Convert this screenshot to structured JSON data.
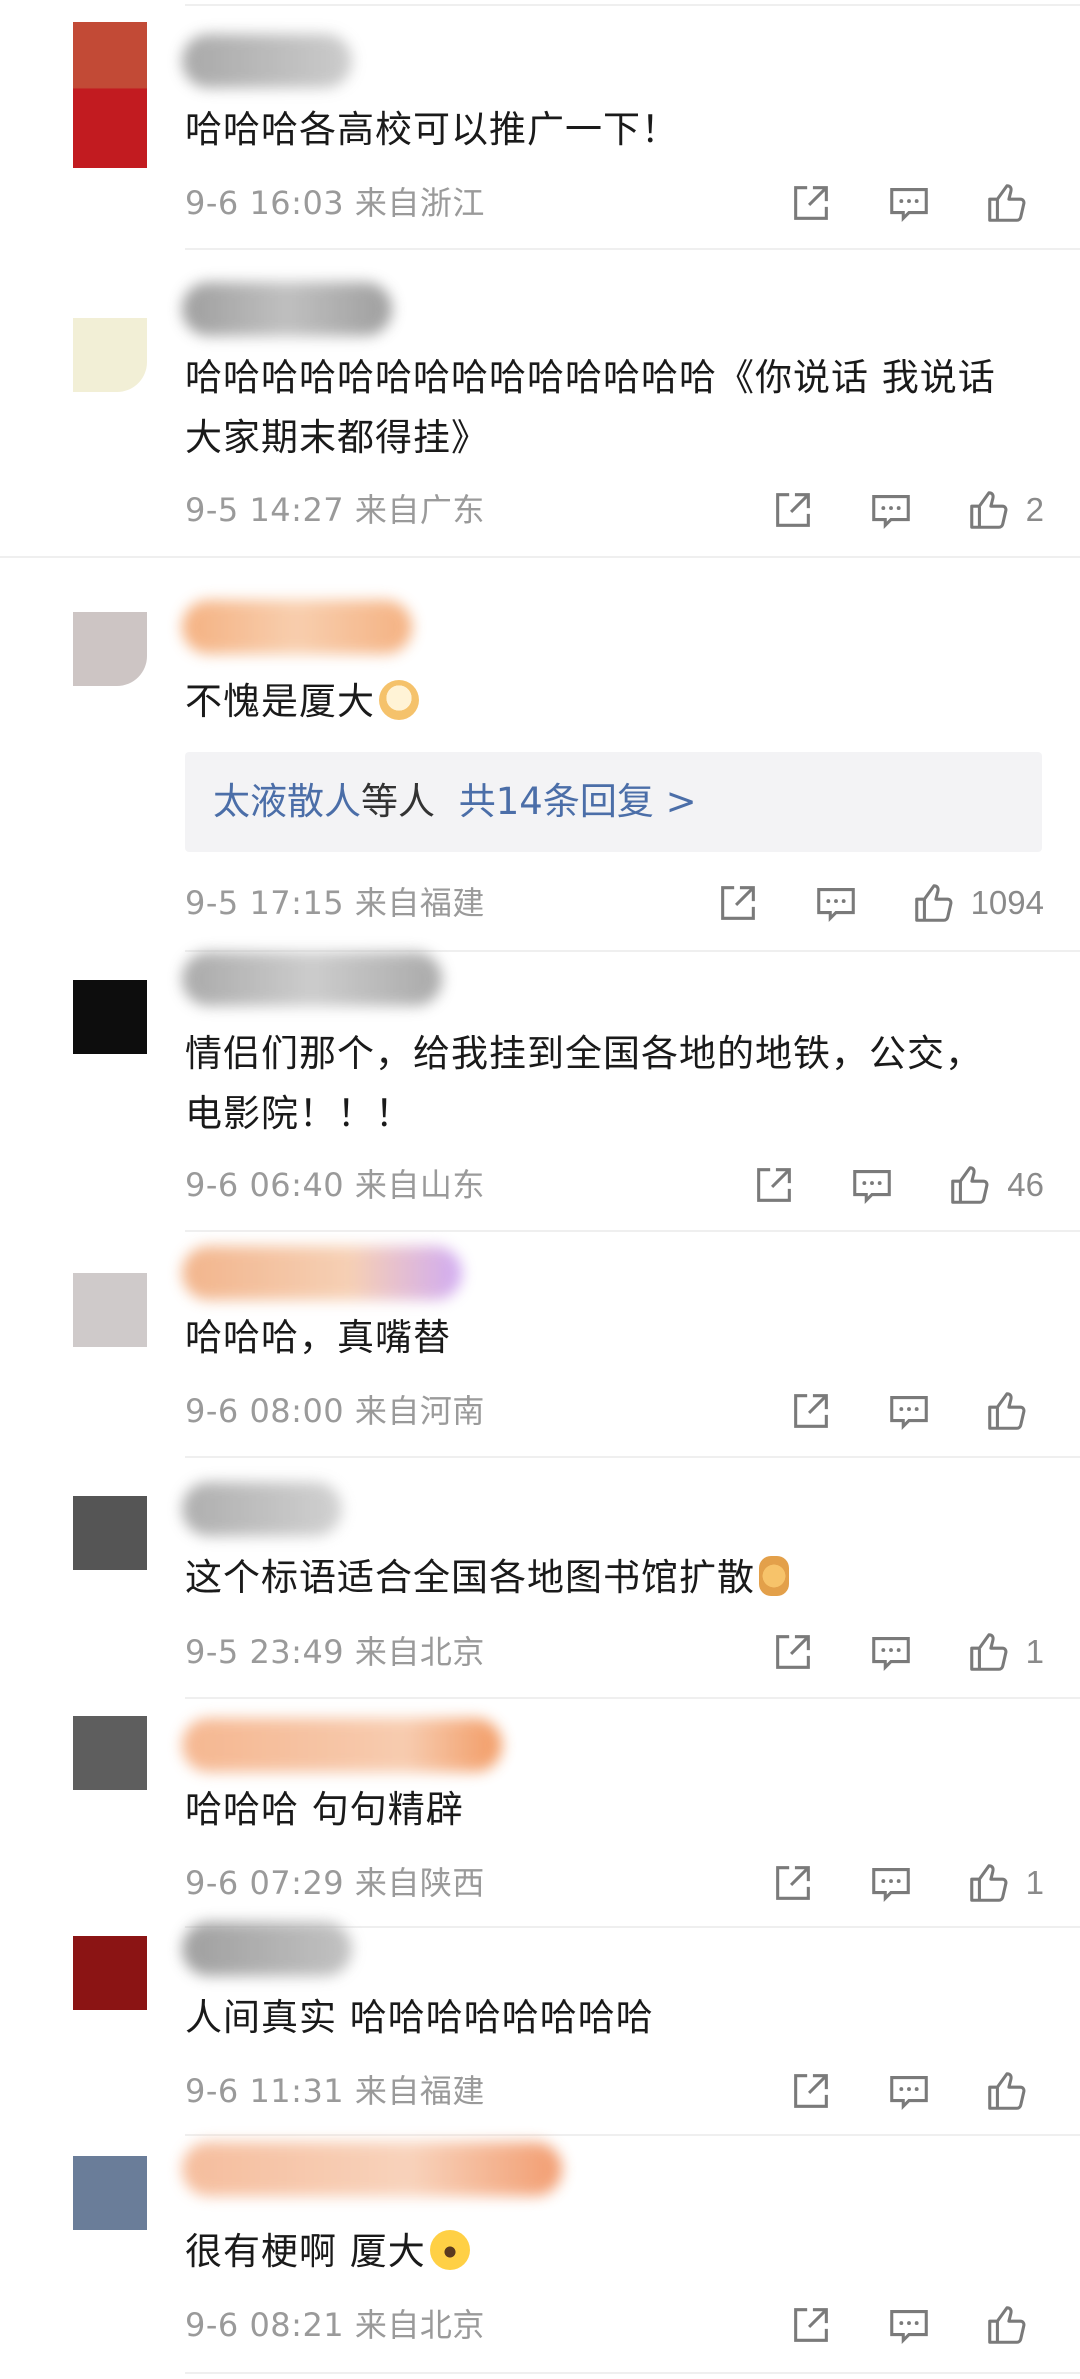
{
  "comments": [
    {
      "avatar_color": "#c0392b",
      "name_colors": [
        "#9a9a9a",
        "#b5b5b5"
      ],
      "text": "哈哈哈各高校可以推广一下！",
      "time": "9-6 16:03",
      "location": "来自浙江",
      "likes": ""
    },
    {
      "avatar_color": "#f2efd6",
      "name_colors": [
        "#8e8e8e",
        "#a8a8a8"
      ],
      "text": "哈哈哈哈哈哈哈哈哈哈哈哈哈哈《你说话 我说话 大家期末都得挂》",
      "time": "9-5 14:27",
      "location": "来自广东",
      "likes": "2"
    },
    {
      "avatar_color": "#cdc5c4",
      "name_colors": [
        "#f2a46f",
        "#f7b98a"
      ],
      "text": "不愧是厦大",
      "emoji": "dog-emoji",
      "reply": {
        "names": "太液散人",
        "middle": "等人",
        "count": "共14条回复 >"
      },
      "time": "9-5 17:15",
      "location": "来自福建",
      "likes": "1094"
    },
    {
      "avatar_color": "#0d0d0d",
      "name_colors": [
        "#9b9b9b",
        "#b8b8b8"
      ],
      "text": "情侣们那个，给我挂到全国各地的地铁，公交，电影院！！！",
      "time": "9-6 06:40",
      "location": "来自山东",
      "likes": "46"
    },
    {
      "avatar_color": "#cfcaca",
      "name_colors": [
        "#f0a878",
        "#c89cf0"
      ],
      "text": "哈哈哈，真嘴替",
      "time": "9-6 08:00",
      "location": "来自河南",
      "likes": ""
    },
    {
      "avatar_color": "#555555",
      "name_colors": [
        "#a0a0a0",
        "#c2c2c2"
      ],
      "text": "这个标语适合全国各地图书馆扩散",
      "emoji": "thumbs-up-emoji",
      "time": "9-5 23:49",
      "location": "来自北京",
      "likes": "1"
    },
    {
      "avatar_color": "#5e5e5e",
      "name_colors": [
        "#f4ab7e",
        "#f08a4a"
      ],
      "text": "哈哈哈 句句精辟",
      "time": "9-6 07:29",
      "location": "来自陕西",
      "likes": "1"
    },
    {
      "avatar_color": "#8b1414",
      "name_colors": [
        "#8f8f8f",
        "#ababab"
      ],
      "text": "人间真实 哈哈哈哈哈哈哈哈",
      "time": "9-6 11:31",
      "location": "来自福建",
      "likes": ""
    },
    {
      "avatar_color": "#6a7d99",
      "name_colors": [
        "#f4b28c",
        "#f08c58"
      ],
      "text": "很有梗啊 厦大",
      "emoji": "laughing-emoji",
      "time": "9-6 08:21",
      "location": "来自北京",
      "likes": ""
    }
  ]
}
